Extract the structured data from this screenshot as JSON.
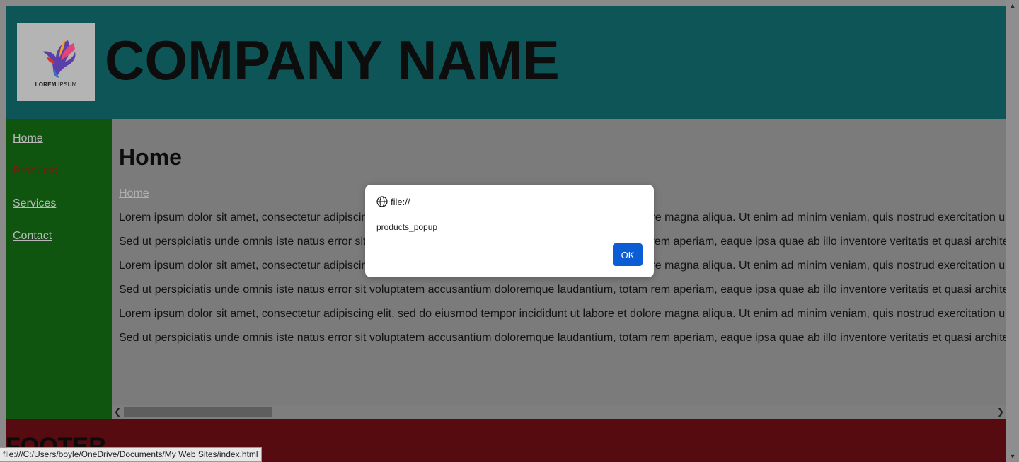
{
  "header": {
    "logo_text_bold": "LOREM",
    "logo_text_rest": " IPSUM",
    "company_name": "COMPANY NAME"
  },
  "nav": {
    "items": [
      {
        "label": "Home"
      },
      {
        "label": "Products"
      },
      {
        "label": "Services"
      },
      {
        "label": "Contact"
      }
    ]
  },
  "main": {
    "heading": "Home",
    "breadcrumb": "Home",
    "paragraphs": [
      "Lorem ipsum dolor sit amet, consectetur adipiscing elit, sed do eiusmod tempor incididunt ut labore et dolore magna aliqua. Ut enim ad minim veniam, quis nostrud exercitation ullamco",
      "Sed ut perspiciatis unde omnis iste natus error sit voluptatem accusantium doloremque laudantium, totam rem aperiam, eaque ipsa quae ab illo inventore veritatis et quasi architecto",
      "Lorem ipsum dolor sit amet, consectetur adipiscing elit, sed do eiusmod tempor incididunt ut labore et dolore magna aliqua. Ut enim ad minim veniam, quis nostrud exercitation ullamco",
      "Sed ut perspiciatis unde omnis iste natus error sit voluptatem accusantium doloremque laudantium, totam rem aperiam, eaque ipsa quae ab illo inventore veritatis et quasi architecto",
      "Lorem ipsum dolor sit amet, consectetur adipiscing elit, sed do eiusmod tempor incididunt ut labore et dolore magna aliqua. Ut enim ad minim veniam, quis nostrud exercitation ullamco",
      "Sed ut perspiciatis unde omnis iste natus error sit voluptatem accusantium doloremque laudantium, totam rem aperiam, eaque ipsa quae ab illo inventore veritatis et quasi architecto"
    ]
  },
  "footer": {
    "label": "FOOTER"
  },
  "status_bar": {
    "url": "file:///C:/Users/boyle/OneDrive/Documents/My Web Sites/index.html"
  },
  "dialog": {
    "origin": "file://",
    "message": "products_popup",
    "ok_label": "OK"
  },
  "colors": {
    "header_bg": "#0e5557",
    "nav_bg": "#0f540f",
    "footer_bg": "#550b0f",
    "ok_button": "#0b5cd5",
    "active_link": "#7a1a12"
  }
}
